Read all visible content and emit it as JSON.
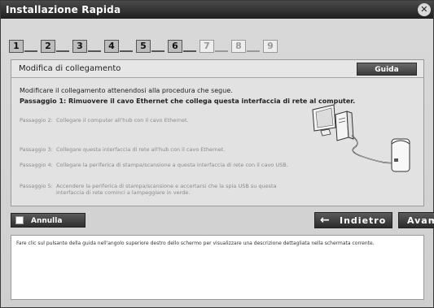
{
  "window": {
    "title": "Installazione Rapida",
    "close_symbol": "✕"
  },
  "steps": [
    {
      "num": "1",
      "dim": false
    },
    {
      "num": "2",
      "dim": false
    },
    {
      "num": "3",
      "dim": false
    },
    {
      "num": "4",
      "dim": false
    },
    {
      "num": "5",
      "dim": false
    },
    {
      "num": "6",
      "dim": false
    },
    {
      "num": "7",
      "dim": true
    },
    {
      "num": "8",
      "dim": true
    },
    {
      "num": "9",
      "dim": true
    }
  ],
  "panel": {
    "title": "Modifica di collegamento",
    "guide_label": "Guida",
    "intro": "Modificare il collegamento attenendosi alla procedura che segue.",
    "step1": "Passaggio 1: Rimuovere il cavo Ethernet che collega questa interfaccia di rete al computer.",
    "substeps": [
      {
        "label": "Passaggio 2:",
        "text": "Collegare il computer all'hub con il cavo Ethernet."
      },
      {
        "label": "Passaggio 3:",
        "text": "Collegare questa interfaccia di rete all'hub con il cavo Ethernet."
      },
      {
        "label": "Passaggio 4:",
        "text": "Collegare la periferica di stampa/scansione a questa interfaccia di rete con il cavo USB."
      },
      {
        "label": "Passaggio 5:",
        "text": "Accendere la periferica di stampa/scansione e accertarsi che la spia USB su questa interfaccia di rete cominci a lampeggiare in verde."
      }
    ]
  },
  "buttons": {
    "cancel": "Annulla",
    "back": "Indietro",
    "next": "Avanti"
  },
  "help_text": "Fare clic sul pulsante della guida nell'angolo superiore destro dello schermo per visualizzare una descrizione dettagliata nella schermata corrente."
}
